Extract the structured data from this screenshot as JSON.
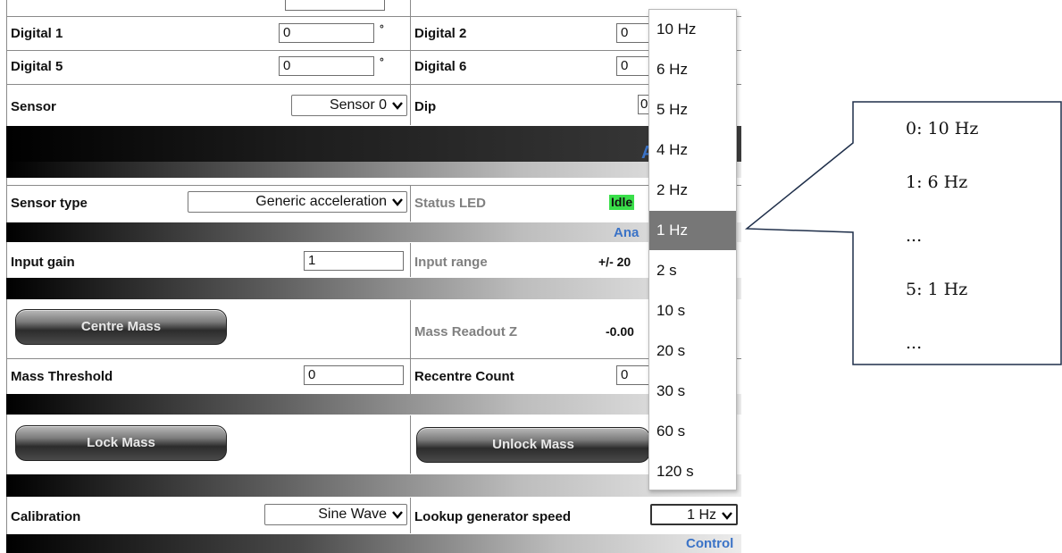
{
  "rows": {
    "digital1": {
      "label": "Digital 1",
      "value": "0",
      "unit": "°"
    },
    "digital2": {
      "label": "Digital 2",
      "value": "0"
    },
    "digital5": {
      "label": "Digital 5",
      "value": "0",
      "unit": "°"
    },
    "digital6": {
      "label": "Digital 6",
      "value": "0"
    },
    "sensor": {
      "label": "Sensor",
      "value": "Sensor 0"
    },
    "dip": {
      "label": "Dip",
      "value": "0"
    },
    "sensor_type": {
      "label": "Sensor type",
      "value": "Generic acceleration"
    },
    "status_led": {
      "label": "Status LED",
      "value": "Idle"
    },
    "input_gain": {
      "label": "Input gain",
      "value": "1"
    },
    "input_range": {
      "label": "Input range",
      "value": "+/- 20"
    },
    "mass_readout_z": {
      "label": "Mass Readout Z",
      "value": "-0.00"
    },
    "mass_threshold": {
      "label": "Mass Threshold",
      "value": "0"
    },
    "recentre_count": {
      "label": "Recentre Count",
      "value": "0"
    },
    "calibration": {
      "label": "Calibration",
      "value": "Sine Wave"
    },
    "lookup_speed": {
      "label": "Lookup generator speed",
      "value": "1 Hz"
    }
  },
  "buttons": {
    "centre_mass": "Centre Mass",
    "lock_mass": "Lock Mass",
    "unlock_mass": "Unlock Mass"
  },
  "section_labels": {
    "a": "A",
    "ana": "Ana",
    "control": "Control"
  },
  "dropdown": {
    "options": [
      "10 Hz",
      "6 Hz",
      "5 Hz",
      "4 Hz",
      "2 Hz",
      "1 Hz",
      "2 s",
      "10 s",
      "20 s",
      "30 s",
      "60 s",
      "120 s"
    ],
    "selected": "1 Hz"
  },
  "callout": {
    "lines": [
      "0: 10 Hz",
      "1: 6 Hz",
      "...",
      "5: 1 Hz",
      "..."
    ]
  },
  "colors": {
    "status_idle_bg": "#3adf4a",
    "section_label": "#3b73c7",
    "dropdown_selected_bg": "#777777",
    "callout_border": "#1f2f4a"
  }
}
